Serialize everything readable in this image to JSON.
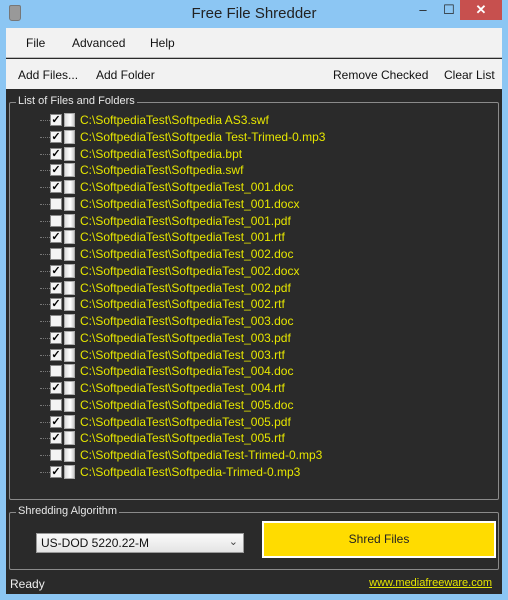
{
  "window": {
    "title": "Free File Shredder",
    "icon": "trash-icon",
    "minimize": "–",
    "maximize": "☐",
    "close": "✕"
  },
  "menu": [
    "File",
    "Advanced",
    "Help"
  ],
  "toolbar": {
    "add_files": "Add Files...",
    "add_folder": "Add Folder",
    "remove_checked": "Remove Checked",
    "clear_list": "Clear List"
  },
  "files_group": {
    "label": "List of Files and Folders",
    "items": [
      {
        "path": "C:\\SoftpediaTest\\Softpedia AS3.swf",
        "checked": true
      },
      {
        "path": "C:\\SoftpediaTest\\Softpedia Test-Trimed-0.mp3",
        "checked": true
      },
      {
        "path": "C:\\SoftpediaTest\\Softpedia.bpt",
        "checked": true
      },
      {
        "path": "C:\\SoftpediaTest\\Softpedia.swf",
        "checked": true
      },
      {
        "path": "C:\\SoftpediaTest\\SoftpediaTest_001.doc",
        "checked": true
      },
      {
        "path": "C:\\SoftpediaTest\\SoftpediaTest_001.docx",
        "checked": false
      },
      {
        "path": "C:\\SoftpediaTest\\SoftpediaTest_001.pdf",
        "checked": false
      },
      {
        "path": "C:\\SoftpediaTest\\SoftpediaTest_001.rtf",
        "checked": true
      },
      {
        "path": "C:\\SoftpediaTest\\SoftpediaTest_002.doc",
        "checked": false
      },
      {
        "path": "C:\\SoftpediaTest\\SoftpediaTest_002.docx",
        "checked": true
      },
      {
        "path": "C:\\SoftpediaTest\\SoftpediaTest_002.pdf",
        "checked": true
      },
      {
        "path": "C:\\SoftpediaTest\\SoftpediaTest_002.rtf",
        "checked": true
      },
      {
        "path": "C:\\SoftpediaTest\\SoftpediaTest_003.doc",
        "checked": false
      },
      {
        "path": "C:\\SoftpediaTest\\SoftpediaTest_003.pdf",
        "checked": true
      },
      {
        "path": "C:\\SoftpediaTest\\SoftpediaTest_003.rtf",
        "checked": true
      },
      {
        "path": "C:\\SoftpediaTest\\SoftpediaTest_004.doc",
        "checked": false
      },
      {
        "path": "C:\\SoftpediaTest\\SoftpediaTest_004.rtf",
        "checked": true
      },
      {
        "path": "C:\\SoftpediaTest\\SoftpediaTest_005.doc",
        "checked": false
      },
      {
        "path": "C:\\SoftpediaTest\\SoftpediaTest_005.pdf",
        "checked": true
      },
      {
        "path": "C:\\SoftpediaTest\\SoftpediaTest_005.rtf",
        "checked": true
      },
      {
        "path": "C:\\SoftpediaTest\\SoftpediaTest-Trimed-0.mp3",
        "checked": false
      },
      {
        "path": "C:\\SoftpediaTest\\Softpedia-Trimed-0.mp3",
        "checked": true
      }
    ]
  },
  "algorithm_group": {
    "label": "Shredding Algorithm",
    "selected": "US-DOD 5220.22-M",
    "shred_button": "Shred Files"
  },
  "status": {
    "text": "Ready",
    "link": "www.mediafreeware.com"
  },
  "colors": {
    "accent": "#ffdc00",
    "file_text": "#e6e600",
    "background": "#2a2a2a",
    "close": "#c7504e"
  }
}
